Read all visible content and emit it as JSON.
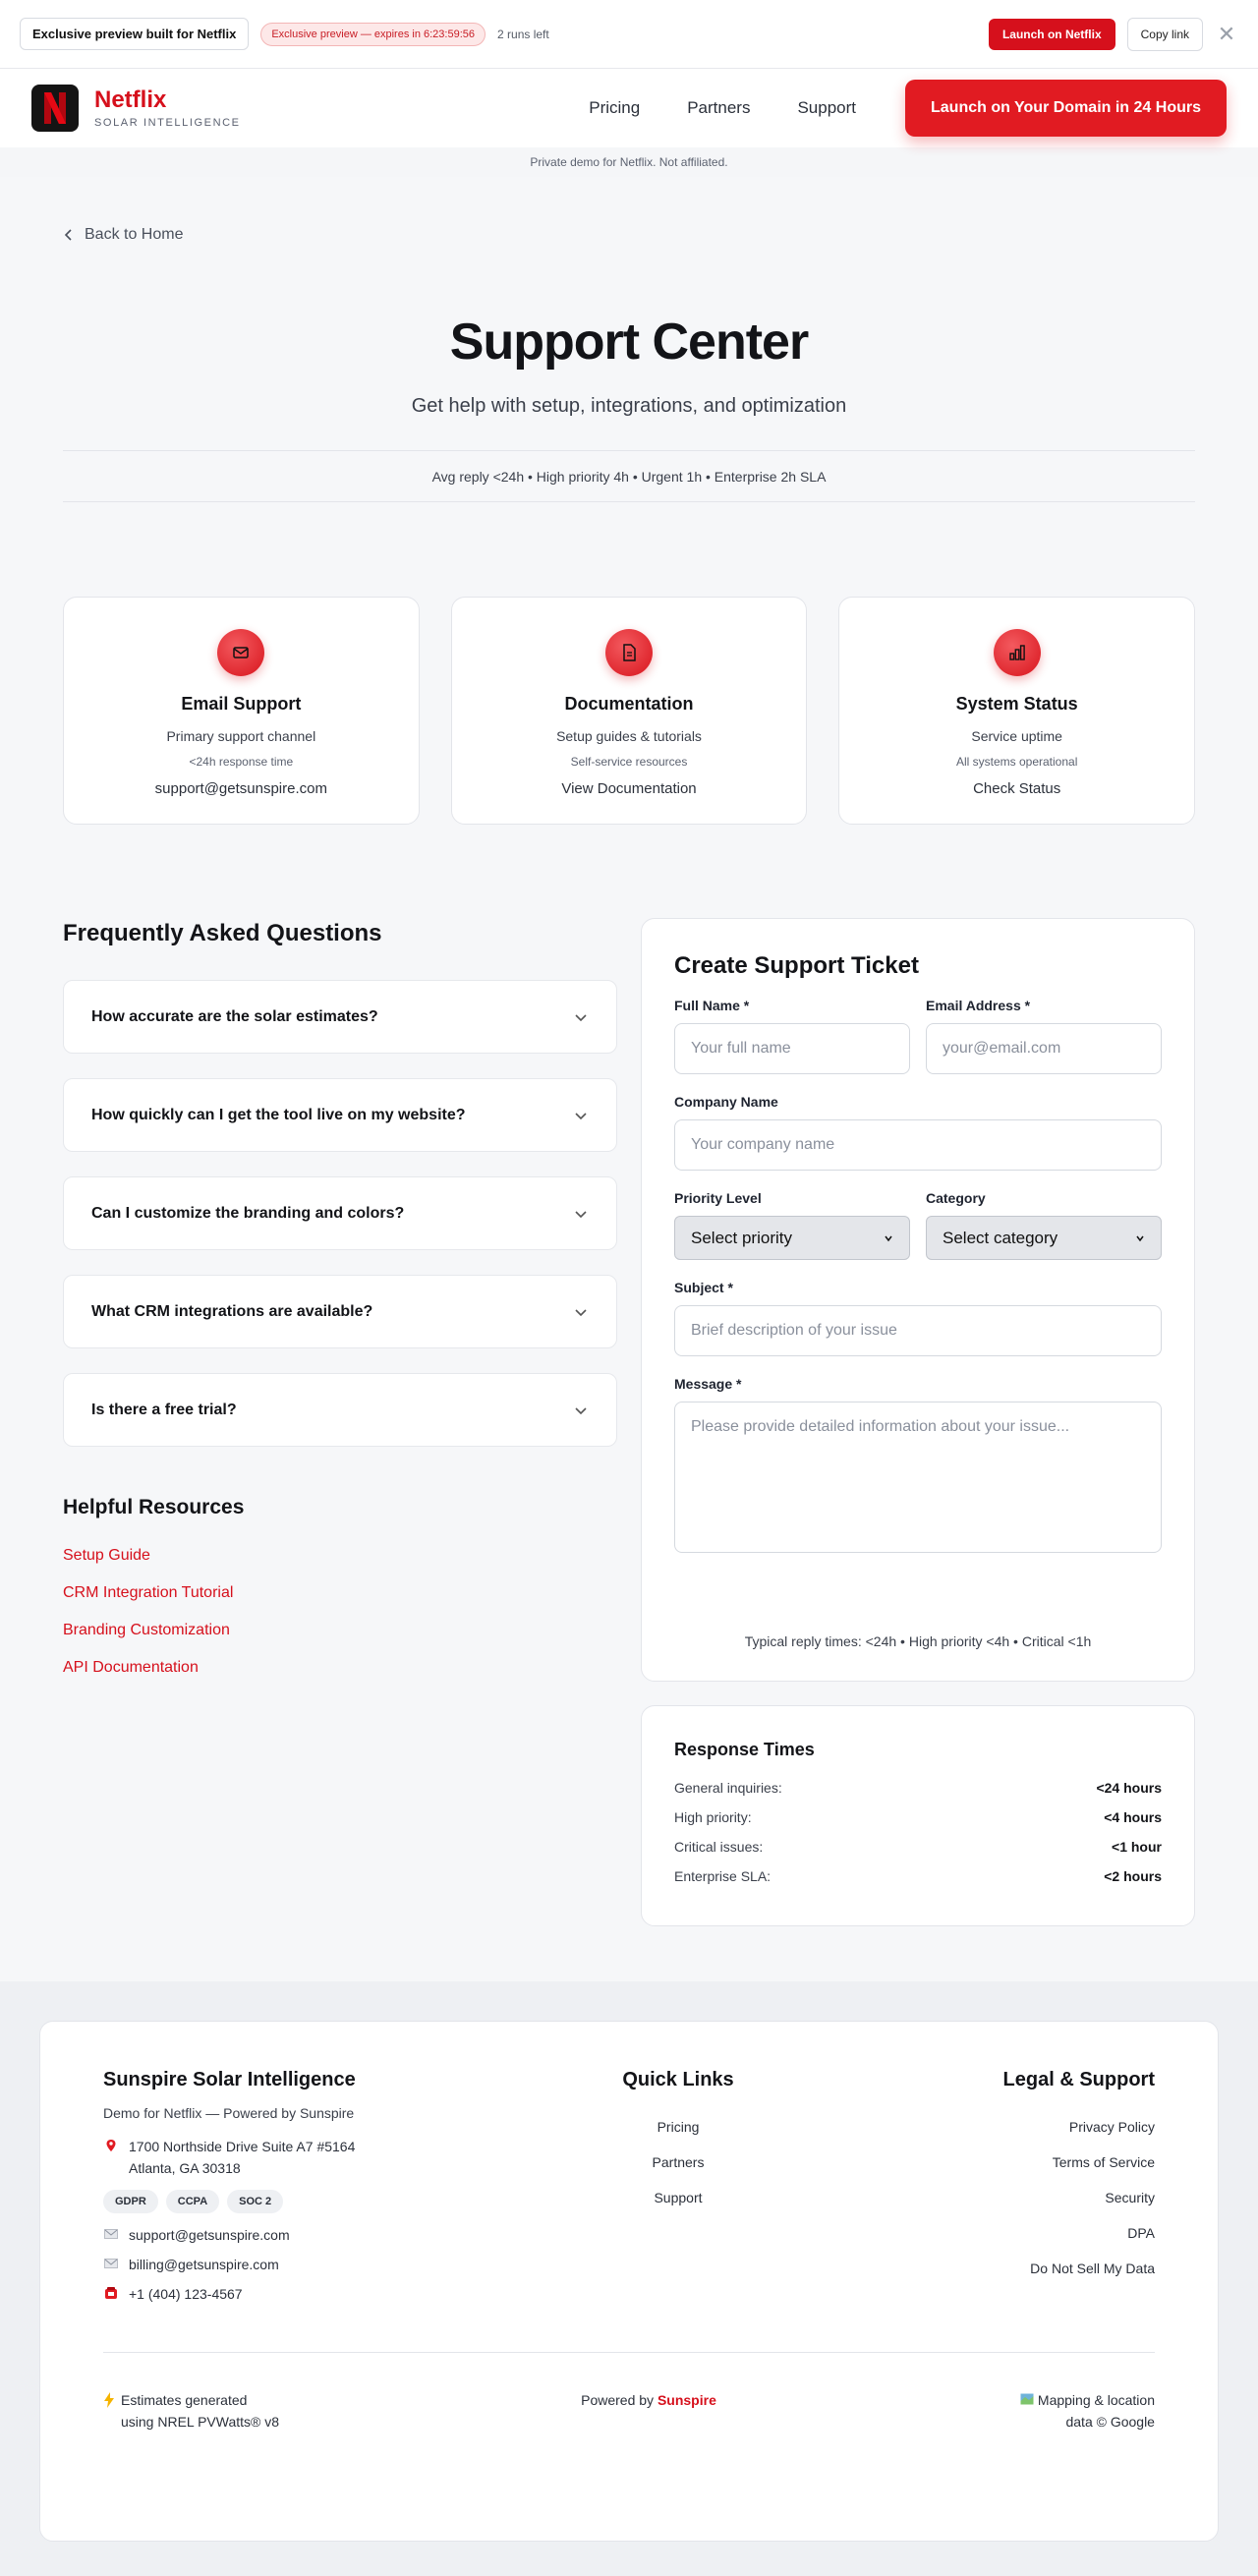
{
  "preview": {
    "built_for": "Exclusive preview built for Netflix",
    "expires": "Exclusive preview — expires in 6:23:59:56",
    "runs_left": "2 runs left",
    "launch_button": "Launch on Netflix",
    "copy_button": "Copy link",
    "close_glyph": "✕"
  },
  "nav": {
    "brand_name": "Netflix",
    "brand_sub": "SOLAR INTELLIGENCE",
    "logo_letter": "N",
    "links": [
      "Pricing",
      "Partners",
      "Support"
    ],
    "cta": "Launch on Your Domain in 24 Hours",
    "disclaimer": "Private demo for Netflix. Not affiliated."
  },
  "page": {
    "back_link": "Back to Home",
    "title": "Support Center",
    "subtitle": "Get help with setup, integrations, and optimization",
    "sla_strip": "Avg reply <24h • High priority 4h • Urgent 1h • Enterprise 2h SLA"
  },
  "cards": [
    {
      "icon": "mail-icon",
      "title": "Email Support",
      "desc": "Primary support channel",
      "note": "<24h response time",
      "link": "support@getsunspire.com"
    },
    {
      "icon": "document-icon",
      "title": "Documentation",
      "desc": "Setup guides & tutorials",
      "note": "Self-service resources",
      "link": "View Documentation"
    },
    {
      "icon": "bar-chart-icon",
      "title": "System Status",
      "desc": "Service uptime",
      "note": "All systems operational",
      "link": "Check Status"
    }
  ],
  "faq": {
    "heading": "Frequently Asked Questions",
    "items": [
      "How accurate are the solar estimates?",
      "How quickly can I get the tool live on my website?",
      "Can I customize the branding and colors?",
      "What CRM integrations are available?",
      "Is there a free trial?"
    ]
  },
  "resources": {
    "heading": "Helpful Resources",
    "links": [
      "Setup Guide",
      "CRM Integration Tutorial",
      "Branding Customization",
      "API Documentation"
    ]
  },
  "ticket": {
    "title": "Create Support Ticket",
    "full_name_label": "Full Name *",
    "full_name_placeholder": "Your full name",
    "email_label": "Email Address *",
    "email_placeholder": "your@email.com",
    "company_label": "Company Name",
    "company_placeholder": "Your company name",
    "priority_label": "Priority Level",
    "priority_value": "Select priority",
    "category_label": "Category",
    "category_value": "Select category",
    "subject_label": "Subject *",
    "subject_placeholder": "Brief description of your issue",
    "message_label": "Message *",
    "message_placeholder": "Please provide detailed information about your issue...",
    "footer": "Typical reply times: <24h • High priority <4h • Critical <1h"
  },
  "response_times": {
    "title": "Response Times",
    "rows": [
      {
        "label": "General inquiries:",
        "value": "<24 hours"
      },
      {
        "label": "High priority:",
        "value": "<4 hours"
      },
      {
        "label": "Critical issues:",
        "value": "<1 hour"
      },
      {
        "label": "Enterprise SLA:",
        "value": "<2 hours"
      }
    ]
  },
  "footer": {
    "company": "Sunspire Solar Intelligence",
    "tagline": "Demo for Netflix — Powered by Sunspire",
    "address_line1": "1700 Northside Drive Suite A7 #5164",
    "address_line2": "Atlanta, GA 30318",
    "badges": [
      "GDPR",
      "CCPA",
      "SOC 2"
    ],
    "email_support": "support@getsunspire.com",
    "email_billing": "billing@getsunspire.com",
    "phone": "+1 (404) 123-4567",
    "quick_links_heading": "Quick Links",
    "quick_links": [
      "Pricing",
      "Partners",
      "Support"
    ],
    "legal_heading": "Legal & Support",
    "legal_links": [
      "Privacy Policy",
      "Terms of Service",
      "Security",
      "DPA",
      "Do Not Sell My Data"
    ],
    "estimates_line1": "Estimates generated",
    "estimates_line2": "using NREL PVWatts® v8",
    "powered_by": "Powered by",
    "powered_brand": "Sunspire",
    "mapping_line1": "Mapping & location",
    "mapping_line2": "data © Google"
  },
  "colors": {
    "brand_red": "#d6101c",
    "accent_red": "#e11b22"
  }
}
